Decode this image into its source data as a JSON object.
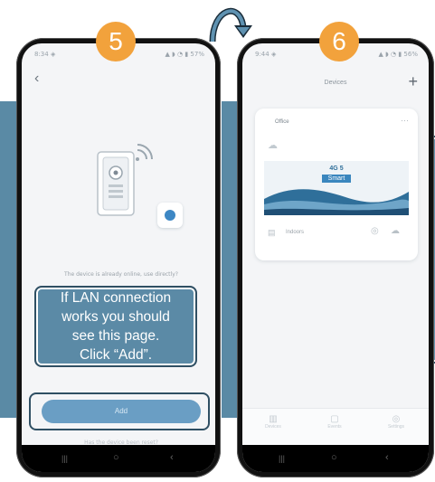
{
  "steps": {
    "left_number": "5",
    "right_number": "6"
  },
  "left_screen": {
    "status_time": "8:34 ◈",
    "status_icons": "▲ ◗ ◔ ▮ 57%",
    "back_label": "‹",
    "device_message": "The device is already online, use directly?",
    "add_button_label": "Add",
    "footer_link": "Has the device been reset?"
  },
  "callout": {
    "lines": [
      "If LAN connection",
      "works you should",
      "see this page.",
      "Click “Add”."
    ]
  },
  "right_screen": {
    "status_time": "9:44 ◈",
    "status_icons": "▲ ◗ ◔ ▮ 56%",
    "header_title": "Devices",
    "add_icon_label": "+",
    "card_title": "Office",
    "card_menu": "···",
    "card_badge_line1": "4G 5",
    "card_badge_line2": "Smart",
    "card_footer_label": "Indoors",
    "tabs": [
      "Devices",
      "Events",
      "Settings"
    ]
  },
  "colors": {
    "side_bar": "#5a8aa5",
    "badge": "#f2a23c",
    "callout": "#5b8aa6",
    "callout_border": "#2f4f63",
    "add_button": "#6a9ec4"
  }
}
